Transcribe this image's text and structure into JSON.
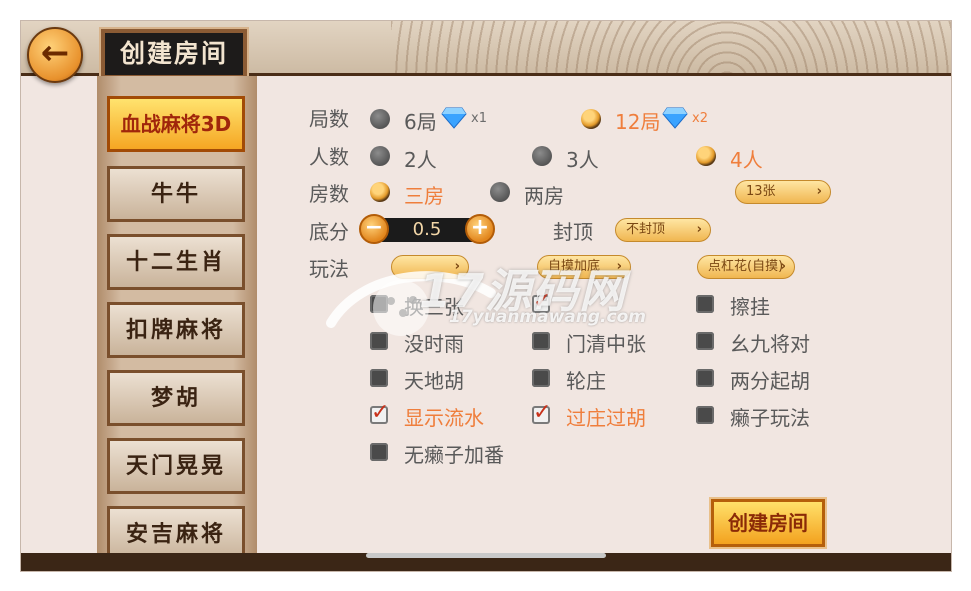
{
  "header": {
    "title": "创建房间",
    "back_icon": "←"
  },
  "sidebar": {
    "items": [
      {
        "label": "血战麻将3D",
        "active": true
      },
      {
        "label": "牛牛",
        "active": false
      },
      {
        "label": "十二生肖",
        "active": false
      },
      {
        "label": "扣牌麻将",
        "active": false
      },
      {
        "label": "梦胡",
        "active": false
      },
      {
        "label": "天门晃晃",
        "active": false
      },
      {
        "label": "安吉麻将",
        "active": false
      }
    ]
  },
  "settings": {
    "rounds": {
      "label": "局数",
      "options": [
        {
          "text": "6局",
          "mult": "x1",
          "selected": false
        },
        {
          "text": "12局",
          "mult": "x2",
          "selected": true
        }
      ]
    },
    "players": {
      "label": "人数",
      "options": [
        {
          "text": "2人",
          "selected": false
        },
        {
          "text": "3人",
          "selected": false
        },
        {
          "text": "4人",
          "selected": true
        }
      ]
    },
    "rooms": {
      "label": "房数",
      "options": [
        {
          "text": "三房",
          "selected": true
        },
        {
          "text": "两房",
          "selected": false
        }
      ],
      "tiles_select": "13张"
    },
    "base_score": {
      "label": "底分",
      "value": "0.5",
      "minus": "−",
      "plus": "+"
    },
    "cap": {
      "label": "封顶",
      "select": "不封顶"
    },
    "play": {
      "label": "玩法",
      "select1": "",
      "select2": "自摸加底",
      "select3": "点杠花(自摸)"
    }
  },
  "rules": [
    {
      "text": "换三张",
      "checked": false
    },
    {
      "text": "",
      "checked": true
    },
    {
      "text": "擦挂",
      "checked": false
    },
    {
      "text": "没时雨",
      "checked": false
    },
    {
      "text": "门清中张",
      "checked": false
    },
    {
      "text": "幺九将对",
      "checked": false
    },
    {
      "text": "天地胡",
      "checked": false
    },
    {
      "text": "轮庄",
      "checked": false
    },
    {
      "text": "两分起胡",
      "checked": false
    },
    {
      "text": "显示流水",
      "checked": true
    },
    {
      "text": "过庄过胡",
      "checked": true
    },
    {
      "text": "癞子玩法",
      "checked": false
    },
    {
      "text": "无癞子加番",
      "checked": false
    }
  ],
  "create_button": "创建房间",
  "watermark": {
    "text": "17源码网",
    "sub": "17yuanmawang.com"
  },
  "colors": {
    "accent": "#ef7e3c",
    "panel": "#f1e6e1",
    "dark": "#3b2616"
  }
}
